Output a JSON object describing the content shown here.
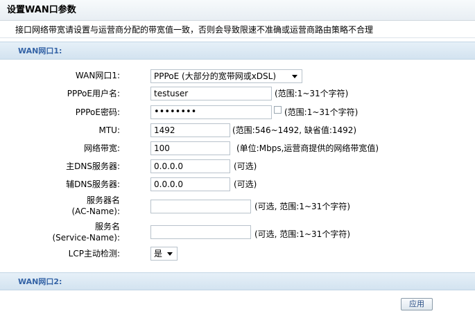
{
  "page": {
    "title": "设置WAN口参数",
    "notice": "接口网络带宽请设置与运营商分配的带宽值一致，否则会导致限速不准确或运营商路由策略不合理"
  },
  "wan1": {
    "header": "WAN网口1:",
    "fields": {
      "wan_port": {
        "label": "WAN网口1:",
        "value": "PPPoE (大部分的宽带网或xDSL)"
      },
      "pppoe_user": {
        "label": "PPPoE用户名:",
        "value": "testuser",
        "hint": "(范围:1~31个字符)"
      },
      "pppoe_pass": {
        "label": "PPPoE密码:",
        "value": "••••••••",
        "hint": "(范围:1~31个字符)"
      },
      "mtu": {
        "label": "MTU:",
        "value": "1492",
        "hint": "(范围:546~1492, 缺省值:1492)"
      },
      "bandwidth": {
        "label": "网络带宽:",
        "value": "100",
        "hint": "(单位:Mbps,运营商提供的网络带宽值)"
      },
      "dns_primary": {
        "label": "主DNS服务器:",
        "value": "0.0.0.0",
        "hint": "(可选)"
      },
      "dns_secondary": {
        "label": "辅DNS服务器:",
        "value": "0.0.0.0",
        "hint": "(可选)"
      },
      "ac_name": {
        "label_line1": "服务器名",
        "label_line2": "(AC-Name):",
        "value": "",
        "hint": "(可选, 范围:1~31个字符)"
      },
      "service_name": {
        "label_line1": "服务名",
        "label_line2": "(Service-Name):",
        "value": "",
        "hint": "(可选, 范围:1~31个字符)"
      },
      "lcp": {
        "label": "LCP主动检测:",
        "value": "是"
      }
    }
  },
  "wan2": {
    "header": "WAN网口2:"
  },
  "actions": {
    "apply": "应用"
  }
}
